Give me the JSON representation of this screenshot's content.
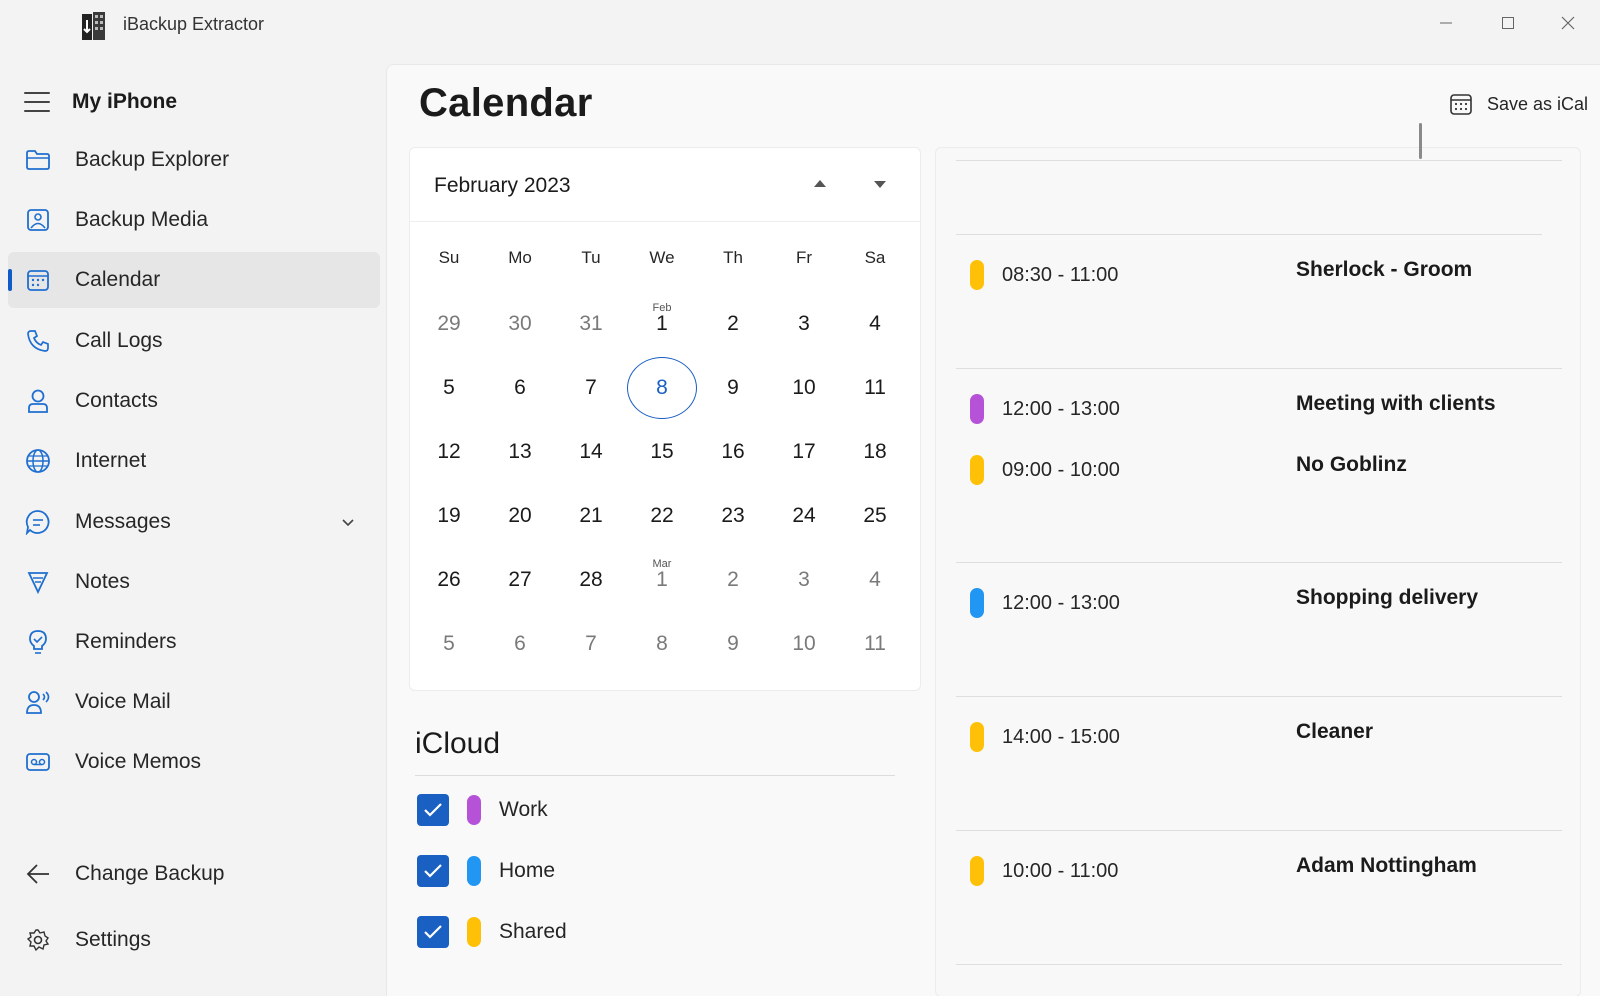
{
  "window": {
    "title": "iBackup Extractor",
    "minimize_icon": "minimize-icon",
    "maximize_icon": "maximize-icon",
    "close_icon": "close-icon"
  },
  "sidebar": {
    "device_name": "My iPhone",
    "items": [
      {
        "label": "Backup Explorer",
        "icon": "folder-icon"
      },
      {
        "label": "Backup Media",
        "icon": "image-icon"
      },
      {
        "label": "Calendar",
        "icon": "calendar-icon",
        "active": true
      },
      {
        "label": "Call Logs",
        "icon": "phone-icon"
      },
      {
        "label": "Contacts",
        "icon": "person-icon"
      },
      {
        "label": "Internet",
        "icon": "globe-icon"
      },
      {
        "label": "Messages",
        "icon": "chat-icon",
        "expandable": true
      },
      {
        "label": "Notes",
        "icon": "notes-icon"
      },
      {
        "label": "Reminders",
        "icon": "reminder-icon"
      },
      {
        "label": "Voice Mail",
        "icon": "voicemail-icon"
      },
      {
        "label": "Voice Memos",
        "icon": "voice-memo-icon"
      }
    ],
    "footer": [
      {
        "label": "Change Backup",
        "icon": "back-arrow-icon"
      },
      {
        "label": "Settings",
        "icon": "gear-icon"
      }
    ]
  },
  "main": {
    "title": "Calendar",
    "save_button": "Save as iCal",
    "accent": "#1a5fc2"
  },
  "calendar": {
    "month_label": "February 2023",
    "weekdays": [
      "Su",
      "Mo",
      "Tu",
      "We",
      "Th",
      "Fr",
      "Sa"
    ],
    "weeks": [
      [
        {
          "d": "29",
          "m": true
        },
        {
          "d": "30",
          "m": true
        },
        {
          "d": "31",
          "m": true
        },
        {
          "d": "1",
          "tag": "Feb"
        },
        {
          "d": "2"
        },
        {
          "d": "3"
        },
        {
          "d": "4"
        }
      ],
      [
        {
          "d": "5"
        },
        {
          "d": "6"
        },
        {
          "d": "7"
        },
        {
          "d": "8",
          "today": true
        },
        {
          "d": "9"
        },
        {
          "d": "10"
        },
        {
          "d": "11"
        }
      ],
      [
        {
          "d": "12"
        },
        {
          "d": "13"
        },
        {
          "d": "14"
        },
        {
          "d": "15"
        },
        {
          "d": "16"
        },
        {
          "d": "17"
        },
        {
          "d": "18"
        }
      ],
      [
        {
          "d": "19"
        },
        {
          "d": "20"
        },
        {
          "d": "21"
        },
        {
          "d": "22"
        },
        {
          "d": "23"
        },
        {
          "d": "24"
        },
        {
          "d": "25"
        }
      ],
      [
        {
          "d": "26"
        },
        {
          "d": "27"
        },
        {
          "d": "28"
        },
        {
          "d": "1",
          "tag": "Mar",
          "m": true
        },
        {
          "d": "2",
          "m": true
        },
        {
          "d": "3",
          "m": true
        },
        {
          "d": "4",
          "m": true
        }
      ],
      [
        {
          "d": "5",
          "m": true
        },
        {
          "d": "6",
          "m": true
        },
        {
          "d": "7",
          "m": true
        },
        {
          "d": "8",
          "m": true
        },
        {
          "d": "9",
          "m": true
        },
        {
          "d": "10",
          "m": true
        },
        {
          "d": "11",
          "m": true
        }
      ]
    ]
  },
  "icloud": {
    "title": "iCloud",
    "calendars": [
      {
        "name": "Work",
        "color": "#b652d8",
        "checked": true
      },
      {
        "name": "Home",
        "color": "#2196f3",
        "checked": true
      },
      {
        "name": "Shared",
        "color": "#ffc107",
        "checked": true
      }
    ]
  },
  "events": [
    {
      "time": "08:30 - 11:00",
      "title": "Sherlock - Groom",
      "color": "#ffc107"
    },
    {
      "time": "12:00 - 13:00",
      "title": "Meeting with clients",
      "color": "#b652d8"
    },
    {
      "time": "09:00 - 10:00",
      "title": "No Goblinz",
      "color": "#ffc107"
    },
    {
      "time": "12:00 - 13:00",
      "title": "Shopping delivery",
      "color": "#2196f3"
    },
    {
      "time": "14:00 - 15:00",
      "title": "Cleaner",
      "color": "#ffc107"
    },
    {
      "time": "10:00 - 11:00",
      "title": "Adam Nottingham",
      "color": "#ffc107"
    }
  ]
}
